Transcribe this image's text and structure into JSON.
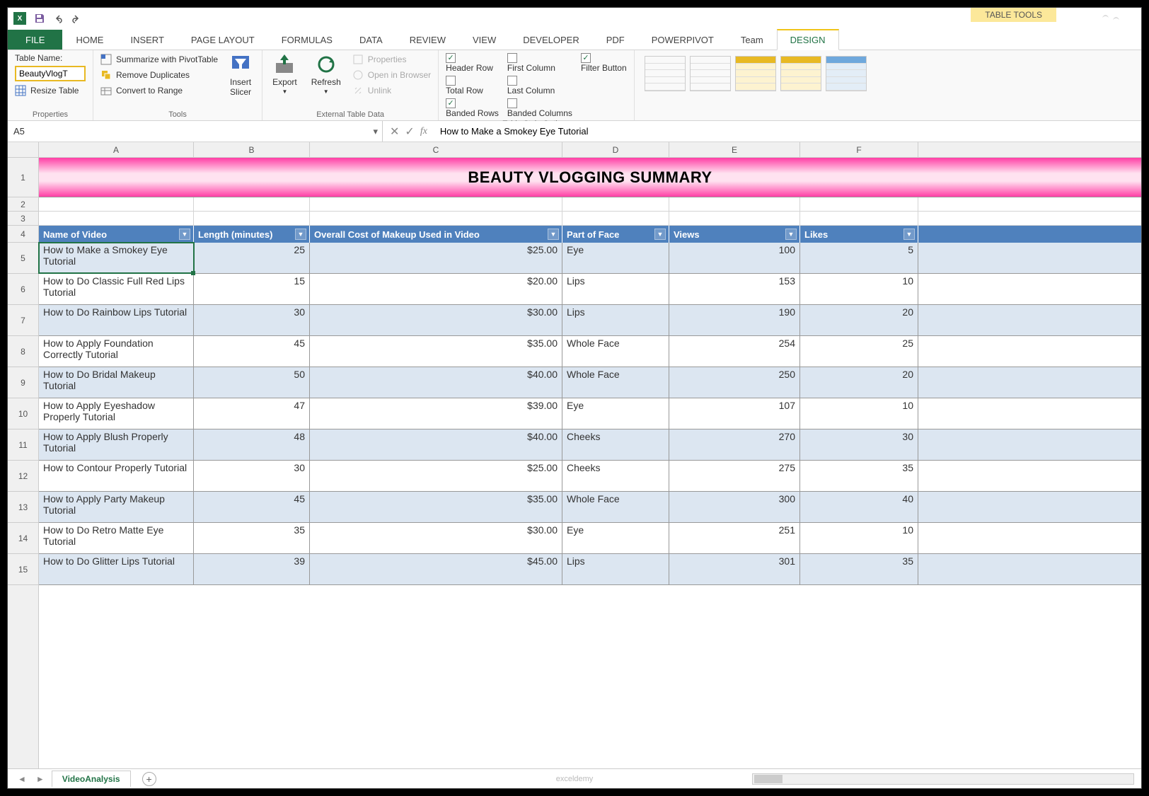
{
  "title_tools": "TABLE TOOLS",
  "ribbon_tabs": [
    "FILE",
    "HOME",
    "INSERT",
    "PAGE LAYOUT",
    "FORMULAS",
    "DATA",
    "REVIEW",
    "VIEW",
    "DEVELOPER",
    "PDF",
    "POWERPIVOT",
    "Team",
    "DESIGN"
  ],
  "ribbon": {
    "properties": {
      "label": "Properties",
      "table_name_label": "Table Name:",
      "table_name_value": "BeautyVlogT",
      "resize": "Resize Table"
    },
    "tools": {
      "label": "Tools",
      "summarize": "Summarize with PivotTable",
      "remove_dup": "Remove Duplicates",
      "convert": "Convert to Range",
      "slicer": "Insert\nSlicer"
    },
    "external": {
      "label": "External Table Data",
      "export": "Export",
      "refresh": "Refresh",
      "props": "Properties",
      "open": "Open in Browser",
      "unlink": "Unlink"
    },
    "style_options": {
      "label": "Table Style Options",
      "header_row": "Header Row",
      "total_row": "Total Row",
      "banded_rows": "Banded Rows",
      "first_col": "First Column",
      "last_col": "Last Column",
      "banded_cols": "Banded Columns",
      "filter_btn": "Filter Button"
    }
  },
  "namebox": "A5",
  "formula": "How to Make a Smokey Eye Tutorial",
  "columns": [
    "A",
    "B",
    "C",
    "D",
    "E",
    "F"
  ],
  "title": "BEAUTY VLOGGING SUMMARY",
  "headers": [
    "Name of Video",
    "Length (minutes)",
    "Overall Cost of Makeup Used in Video",
    "Part of Face",
    "Views",
    "Likes"
  ],
  "chart_data": {
    "type": "table",
    "columns": [
      "Name of Video",
      "Length (minutes)",
      "Overall Cost of Makeup Used in Video",
      "Part of Face",
      "Views",
      "Likes"
    ],
    "rows": [
      [
        "How to Make a Smokey Eye Tutorial",
        25,
        "$25.00",
        "Eye",
        100,
        5
      ],
      [
        "How to Do Classic Full Red Lips Tutorial",
        15,
        "$20.00",
        "Lips",
        153,
        10
      ],
      [
        "How to Do Rainbow Lips Tutorial",
        30,
        "$30.00",
        "Lips",
        190,
        20
      ],
      [
        "How to Apply Foundation Correctly Tutorial",
        45,
        "$35.00",
        "Whole Face",
        254,
        25
      ],
      [
        "How to Do Bridal Makeup Tutorial",
        50,
        "$40.00",
        "Whole Face",
        250,
        20
      ],
      [
        "How to Apply Eyeshadow Properly Tutorial",
        47,
        "$39.00",
        "Eye",
        107,
        10
      ],
      [
        "How to Apply Blush Properly Tutorial",
        48,
        "$40.00",
        "Cheeks",
        270,
        30
      ],
      [
        "How to Contour Properly Tutorial",
        30,
        "$25.00",
        "Cheeks",
        275,
        35
      ],
      [
        "How to Apply Party Makeup Tutorial",
        45,
        "$35.00",
        "Whole Face",
        300,
        40
      ],
      [
        "How to Do Retro Matte Eye Tutorial",
        35,
        "$30.00",
        "Eye",
        251,
        10
      ],
      [
        "How to Do Glitter Lips Tutorial",
        39,
        "$45.00",
        "Lips",
        301,
        35
      ]
    ]
  },
  "sheet_tab": "VideoAnalysis",
  "watermark": "exceldemy"
}
